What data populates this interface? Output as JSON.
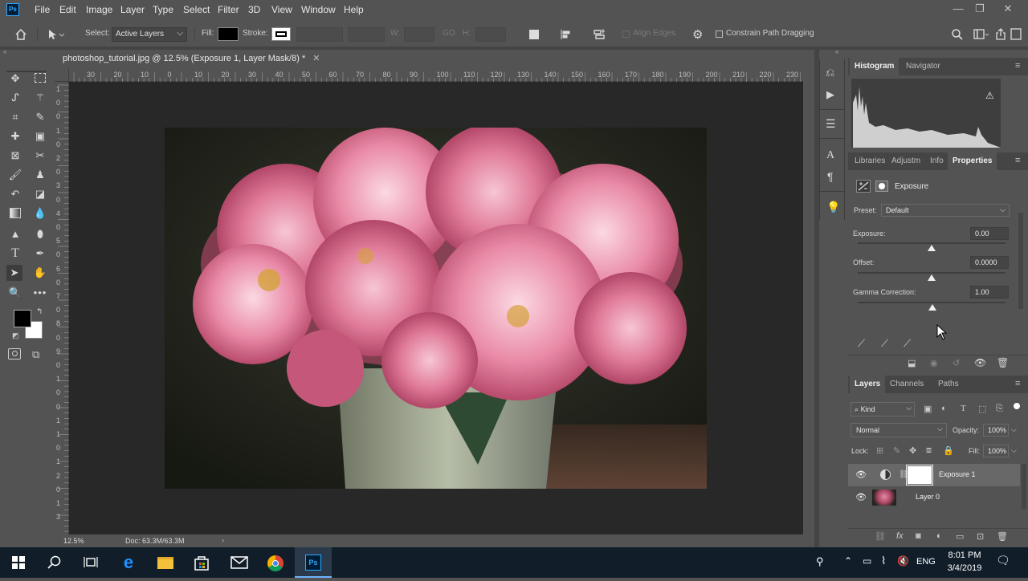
{
  "app": {
    "logo": "Ps"
  },
  "menu": [
    "File",
    "Edit",
    "Image",
    "Layer",
    "Type",
    "Select",
    "Filter",
    "3D",
    "View",
    "Window",
    "Help"
  ],
  "window_controls": {
    "minimize": "—",
    "restore": "❐",
    "close": "✕"
  },
  "options_bar": {
    "select_label": "Select:",
    "select_value": "Active Layers",
    "fill_label": "Fill:",
    "stroke_label": "Stroke:",
    "w_label": "W:",
    "h_label": "H:",
    "go_label": "GO",
    "align_edges": "Align Edges",
    "constrain": "Constrain Path Dragging"
  },
  "document": {
    "tab_title": "photoshop_tutorial.jpg @ 12.5% (Exposure 1, Layer Mask/8) *",
    "ruler_h": [
      "30",
      "20",
      "10",
      "0",
      "10",
      "20",
      "30",
      "40",
      "50",
      "60",
      "70",
      "80",
      "90",
      "100",
      "110",
      "120",
      "130",
      "140",
      "150",
      "160",
      "170",
      "180",
      "190",
      "200",
      "210",
      "220",
      "230"
    ],
    "ruler_v": [
      "1",
      "0",
      "0",
      "1",
      "0",
      "2",
      "0",
      "3",
      "0",
      "4",
      "0",
      "5",
      "0",
      "6",
      "0",
      "7",
      "0",
      "8",
      "0",
      "9",
      "0",
      "1",
      "0",
      "0",
      "1",
      "1",
      "0",
      "1",
      "2",
      "0",
      "1",
      "3"
    ],
    "zoom": "12.5%",
    "doc_info": "Doc: 63.3M/63.3M"
  },
  "panels": {
    "top_tabs": [
      "Histogram",
      "Navigator"
    ],
    "mid_tabs": [
      "Libraries",
      "Adjustm",
      "Info",
      "Properties"
    ],
    "properties": {
      "title": "Exposure",
      "preset_label": "Preset:",
      "preset_value": "Default",
      "exposure_label": "Exposure:",
      "exposure_value": "0.00",
      "offset_label": "Offset:",
      "offset_value": "0.0000",
      "gamma_label": "Gamma Correction:",
      "gamma_value": "1.00"
    },
    "layers_tabs": [
      "Layers",
      "Channels",
      "Paths"
    ],
    "layers": {
      "kind": "Kind",
      "blend": "Normal",
      "opacity_label": "Opacity:",
      "opacity_value": "100%",
      "lock_label": "Lock:",
      "fill_label": "Fill:",
      "fill_value": "100%",
      "items": [
        {
          "name": "Exposure 1"
        },
        {
          "name": "Layer 0"
        }
      ]
    }
  },
  "taskbar": {
    "lang": "ENG",
    "time": "8:01 PM",
    "date": "3/4/2019"
  },
  "colors": {
    "accent": "#31a8ff",
    "panel": "#535353",
    "canvas_bg": "#282828",
    "taskbar": "#111e2a"
  }
}
